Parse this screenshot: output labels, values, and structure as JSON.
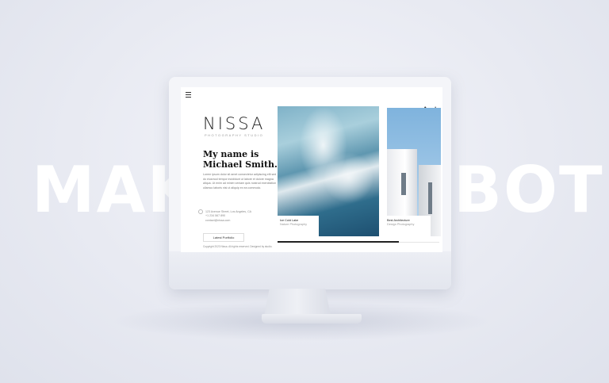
{
  "background_words": {
    "left": "MAK",
    "right": "BOT"
  },
  "site": {
    "logo": "NISSA",
    "tagline": "PHOTOGRAPHY STUDIO",
    "headline": "My name is Michael Smith.",
    "bio": "Lorem ipsum dolor sit amet consectetur adipiscing elit sed do eiusmod tempor incididunt ut labore et dolore magna aliqua. Ut enim ad minim veniam quis nostrud exercitation ullamco laboris nisi ut aliquip ex ea commodo.",
    "contact": {
      "address": "123 Avenue Street, Los Angeles, CA",
      "phone": "+1 234 567 890",
      "email": "contact@nissa.com"
    },
    "portfolio_button": "Latest Portfolio",
    "footer": "Copyright 2023 Nissa. All rights reserved. Designed by studio."
  },
  "gallery": [
    {
      "title": "Ice Cold Lake",
      "subtitle": "Nature Photography"
    },
    {
      "title": "Best Architecture",
      "subtitle": "Design Photography"
    }
  ],
  "slider_progress_percent": 75,
  "icons": [
    "menu-icon",
    "social-icon",
    "info-icon",
    "contact-icon"
  ],
  "colors": {
    "accent": "#111111",
    "background": "#e8eaf2"
  }
}
